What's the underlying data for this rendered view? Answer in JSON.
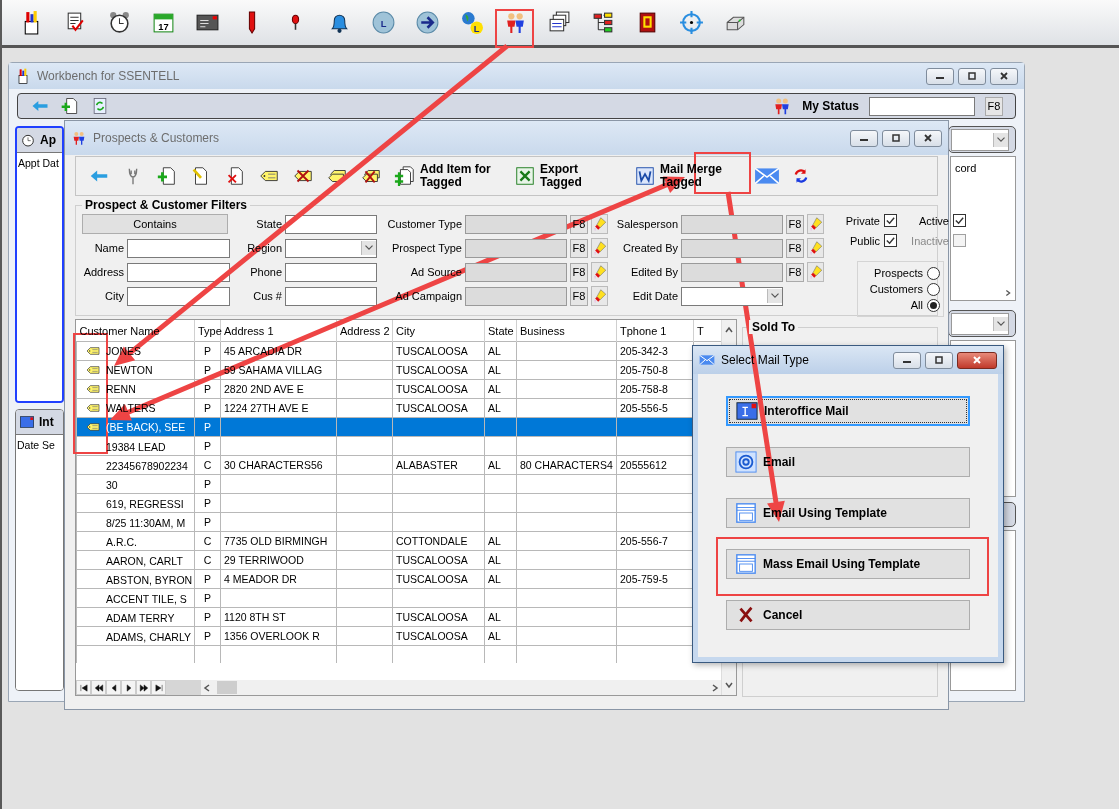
{
  "main_toolbar": {
    "calendar_day": "17",
    "clock_letter": "L",
    "globe_letter": "L"
  },
  "workbench": {
    "title": "Workbench for SSENTELL",
    "status_label": "My Status",
    "status_key": "F8",
    "panels": [
      {
        "title": "Ap",
        "column": "Appt Dat"
      },
      {
        "title": "Int",
        "column": "Date Se"
      }
    ],
    "side_list": {
      "text": "cord"
    }
  },
  "prospects": {
    "title": "Prospects & Customers",
    "toolbar_actions": [
      {
        "label": "Add Item for Tagged",
        "kind": "add"
      },
      {
        "label": "Export Tagged",
        "kind": "excel"
      },
      {
        "label": "Mail Merge Tagged",
        "kind": "word"
      }
    ],
    "filters": {
      "title": "Prospect & Customer Filters",
      "match_button": "Contains",
      "text_fields": [
        {
          "label": "Name"
        },
        {
          "label": "Address"
        },
        {
          "label": "City"
        }
      ],
      "location_fields": [
        {
          "label": "State",
          "kind": "text"
        },
        {
          "label": "Region",
          "kind": "dropdown"
        },
        {
          "label": "Phone",
          "kind": "text"
        },
        {
          "label": "Cus #",
          "kind": "text"
        }
      ],
      "type_lookups": [
        {
          "label": "Customer Type",
          "key": "F8"
        },
        {
          "label": "Prospect Type",
          "key": "F8"
        },
        {
          "label": "Ad Source",
          "key": "F8"
        },
        {
          "label": "Ad Campaign",
          "key": "F8"
        }
      ],
      "user_lookups": [
        {
          "label": "Salesperson",
          "key": "F8"
        },
        {
          "label": "Created By",
          "key": "F8"
        },
        {
          "label": "Edited By",
          "key": "F8"
        }
      ],
      "edit_date": {
        "label": "Edit Date"
      },
      "visibility": [
        {
          "label": "Private",
          "checked": true,
          "disabled": false
        },
        {
          "label": "Active",
          "checked": true,
          "disabled": false
        },
        {
          "label": "Public",
          "checked": true,
          "disabled": false
        },
        {
          "label": "Inactive",
          "checked": false,
          "disabled": true
        }
      ],
      "record_types": [
        {
          "label": "Prospects",
          "selected": false
        },
        {
          "label": "Customers",
          "selected": false
        },
        {
          "label": "All",
          "selected": true
        }
      ]
    },
    "table": {
      "columns": [
        "Customer Name",
        "Type",
        "Address 1",
        "Address 2",
        "City",
        "State",
        "Business",
        "Tphone 1",
        "T"
      ],
      "rows": [
        {
          "tagged": true,
          "selected": false,
          "name": "JONES",
          "type": "P",
          "address_1": "45 ARCADIA DR",
          "city": "TUSCALOOSA",
          "state": "AL",
          "phone_1": "205-342-3"
        },
        {
          "tagged": true,
          "selected": false,
          "name": "NEWTON",
          "type": "P",
          "address_1": "59 SAHAMA VILLAG",
          "city": "TUSCALOOSA",
          "state": "AL",
          "phone_1": "205-750-8"
        },
        {
          "tagged": true,
          "selected": false,
          "name": "RENN",
          "type": "P",
          "address_1": "2820 2ND AVE E",
          "city": "TUSCALOOSA",
          "state": "AL",
          "phone_1": "205-758-8"
        },
        {
          "tagged": true,
          "selected": false,
          "name": "WALTERS",
          "type": "P",
          "address_1": "1224 27TH AVE E",
          "city": "TUSCALOOSA",
          "state": "AL",
          "phone_1": "205-556-5"
        },
        {
          "tagged": true,
          "selected": true,
          "name": "(BE BACK), SEE",
          "type": "P"
        },
        {
          "tagged": false,
          "selected": false,
          "name": "19384 LEAD",
          "type": "P"
        },
        {
          "tagged": false,
          "selected": false,
          "name": "22345678902234",
          "type": "C",
          "address_1": "30 CHARACTERS56",
          "city": "ALABASTER",
          "state": "AL",
          "business": "80 CHARACTERS4",
          "phone_1": "20555612"
        },
        {
          "tagged": false,
          "selected": false,
          "name": "30",
          "type": "P"
        },
        {
          "tagged": false,
          "selected": false,
          "name": "619, REGRESSI",
          "type": "P"
        },
        {
          "tagged": false,
          "selected": false,
          "name": "8/25 11:30AM, M",
          "type": "P"
        },
        {
          "tagged": false,
          "selected": false,
          "name": "A.R.C.",
          "type": "C",
          "address_1": "7735 OLD BIRMINGH",
          "city": "COTTONDALE",
          "state": "AL",
          "phone_1": "205-556-7"
        },
        {
          "tagged": false,
          "selected": false,
          "name": "AARON, CARLT",
          "type": "C",
          "address_1": "29 TERRIWOOD",
          "city": "TUSCALOOSA",
          "state": "AL"
        },
        {
          "tagged": false,
          "selected": false,
          "name": "ABSTON, BYRON",
          "type": "P",
          "address_1": "4 MEADOR DR",
          "city": "TUSCALOOSA",
          "state": "AL",
          "phone_1": "205-759-5"
        },
        {
          "tagged": false,
          "selected": false,
          "name": "ACCENT TILE, S",
          "type": "P"
        },
        {
          "tagged": false,
          "selected": false,
          "name": "ADAM  TERRY",
          "type": "P",
          "address_1": "1120 8TH ST",
          "city": "TUSCALOOSA",
          "state": "AL"
        },
        {
          "tagged": false,
          "selected": false,
          "name": "ADAMS, CHARLY",
          "type": "P",
          "address_1": "1356 OVERLOOK R",
          "city": "TUSCALOOSA",
          "state": "AL"
        }
      ]
    },
    "sold_to": {
      "title": "Sold To"
    }
  },
  "dialog": {
    "title": "Select Mail Type",
    "options": [
      {
        "label": "Interoffice Mail",
        "kind": "interoffice",
        "focused": true
      },
      {
        "label": "Email",
        "kind": "email",
        "focused": false
      },
      {
        "label": "Email Using Template",
        "kind": "template",
        "focused": false
      },
      {
        "label": "Mass Email Using Template",
        "kind": "template",
        "focused": false
      },
      {
        "label": "Cancel",
        "kind": "cancel",
        "focused": false
      }
    ]
  }
}
